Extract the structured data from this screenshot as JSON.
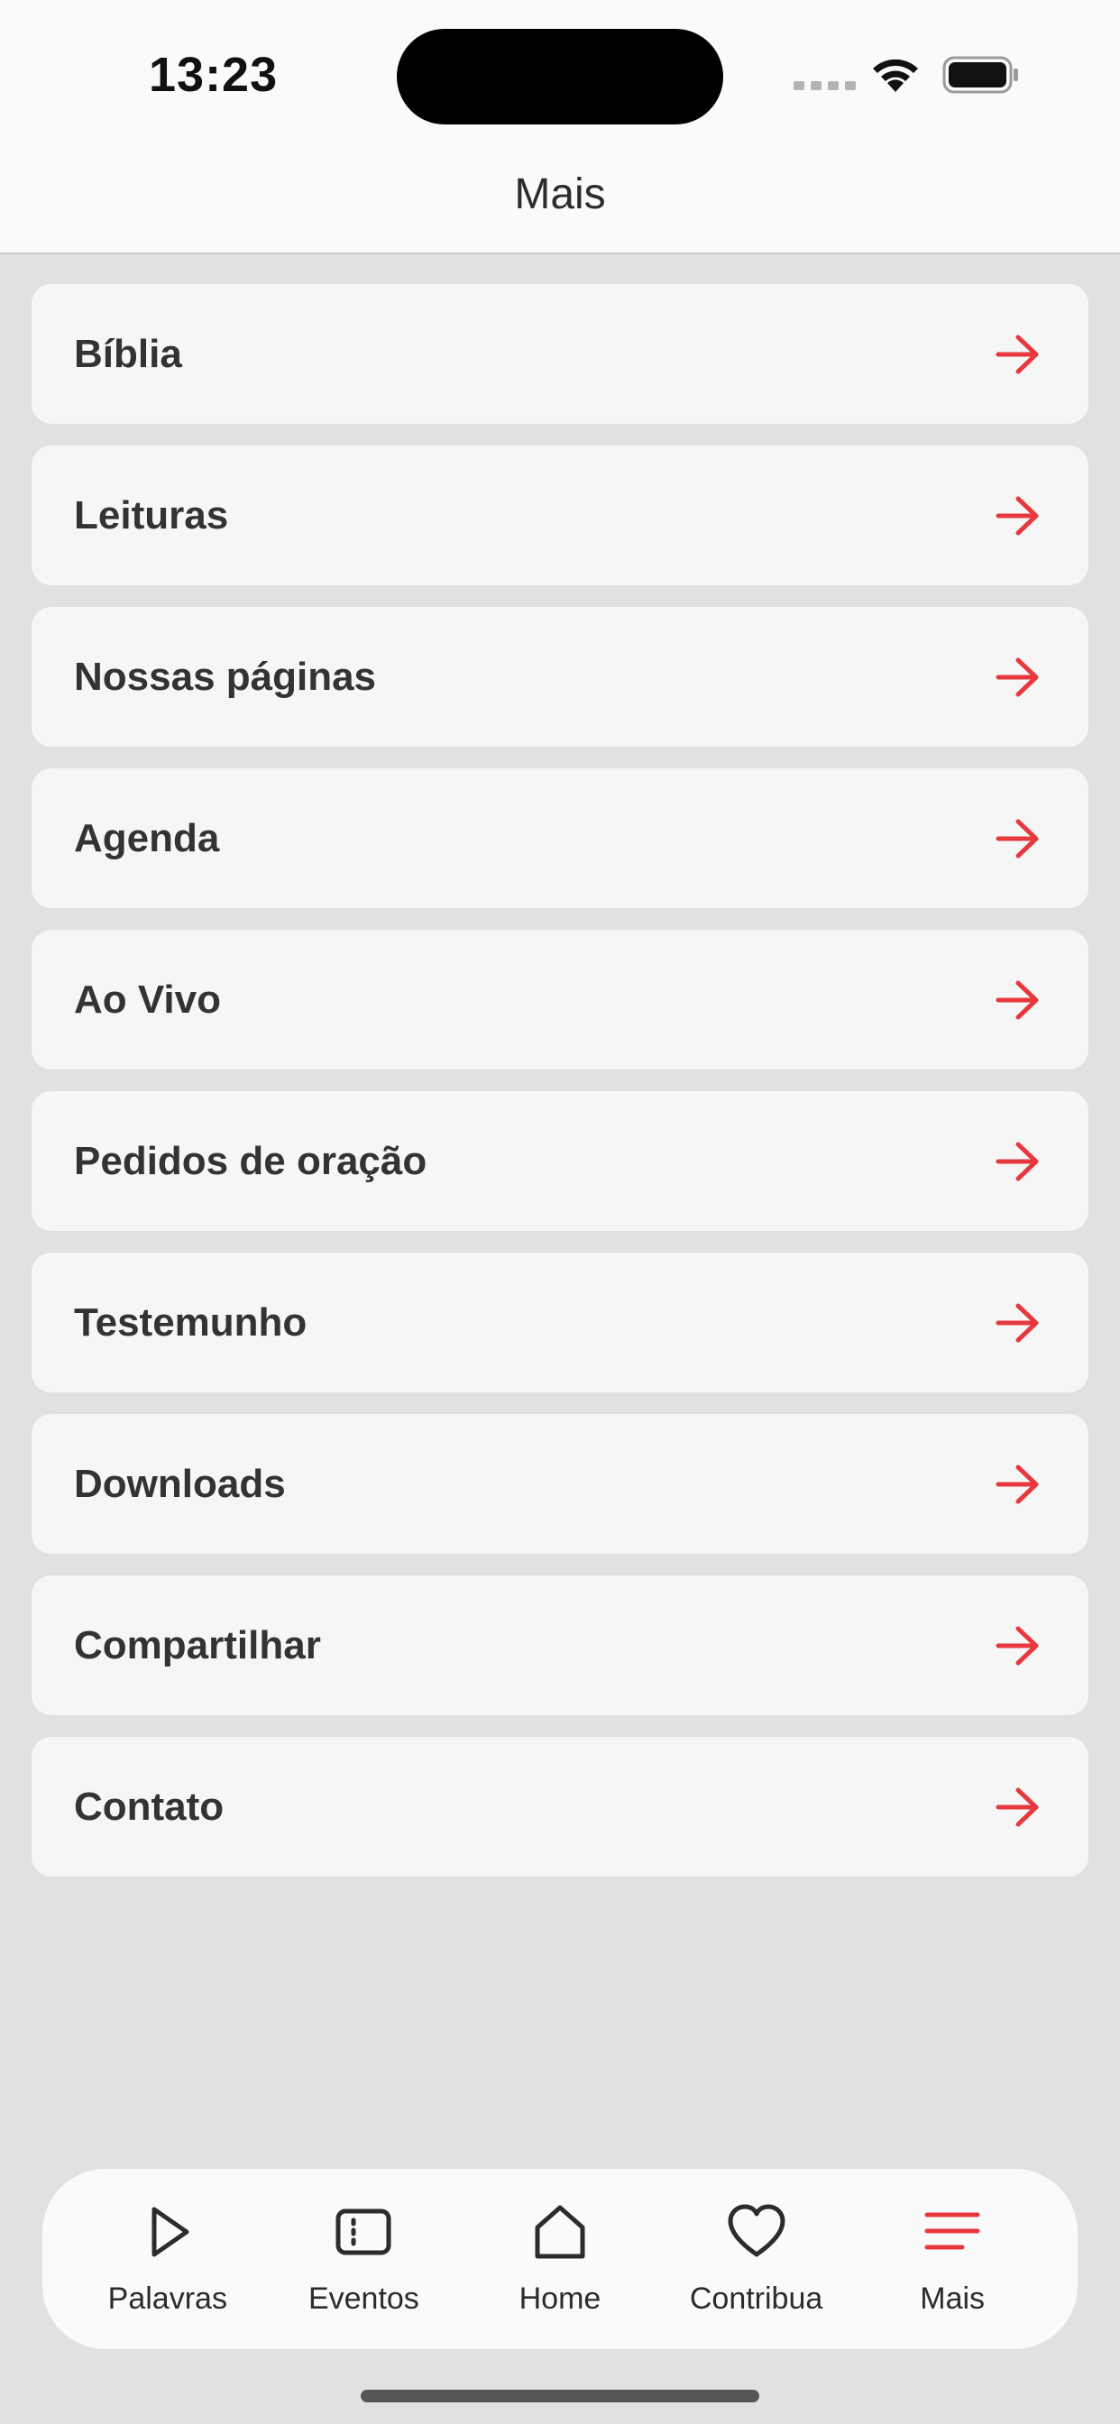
{
  "status_bar": {
    "time": "13:23"
  },
  "header": {
    "title": "Mais"
  },
  "menu": {
    "items": [
      {
        "label": "Bíblia"
      },
      {
        "label": "Leituras"
      },
      {
        "label": "Nossas páginas"
      },
      {
        "label": "Agenda"
      },
      {
        "label": "Ao Vivo"
      },
      {
        "label": "Pedidos de oração"
      },
      {
        "label": "Testemunho"
      },
      {
        "label": "Downloads"
      },
      {
        "label": "Compartilhar"
      },
      {
        "label": "Contato"
      }
    ],
    "arrow_icon": "arrow-right-icon"
  },
  "tabbar": {
    "tabs": [
      {
        "label": "Palavras",
        "icon": "play-icon",
        "active": false
      },
      {
        "label": "Eventos",
        "icon": "ticket-icon",
        "active": false
      },
      {
        "label": "Home",
        "icon": "home-icon",
        "active": false
      },
      {
        "label": "Contribua",
        "icon": "heart-icon",
        "active": false
      },
      {
        "label": "Mais",
        "icon": "menu-icon",
        "active": true
      }
    ]
  },
  "colors": {
    "accent": "#e8383d",
    "background": "#e1e1e1",
    "card": "#f6f6f6",
    "header": "#fafafa",
    "text": "#2c2c2c"
  }
}
